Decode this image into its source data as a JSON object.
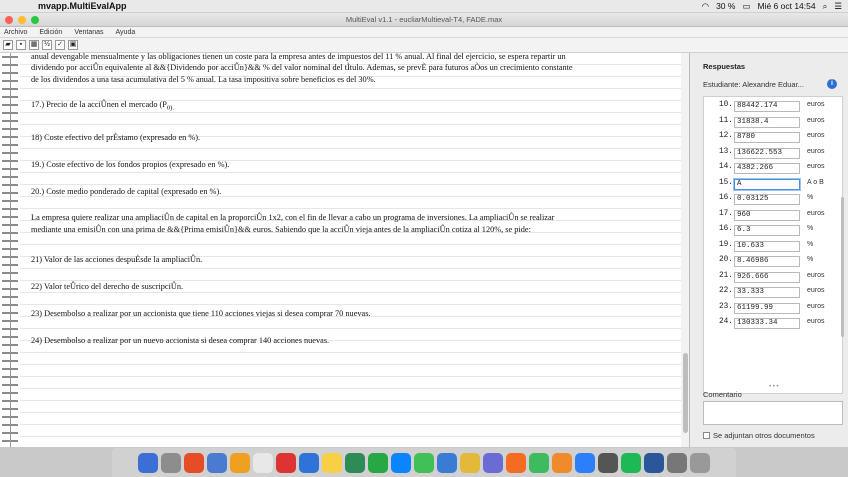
{
  "menubar": {
    "app_name": "mvapp.MultiEvalApp",
    "battery": "30 %",
    "datetime": "Mié 6 oct  14:54"
  },
  "window": {
    "title": "MultiEval v1.1 - eucliarMultieval-T4, FADE.max"
  },
  "app_menu": [
    "Archivo",
    "Edición",
    "Ventanas",
    "Ayuda"
  ],
  "document": {
    "paragraphs": [
      "anual devengable mensualmente y las obligaciones tienen un coste para la empresa antes de impuestos del 11 % anual. Al final del ejercicio, se espera repartir un",
      "dividendo por acciÛn equivalente al &&{Dividendo por acciÛn}&& % del valor nominal del tÌtulo. Ademas, se prevÈ para futuros aÒos un crecimiento constante",
      "de los dividendos a una tasa acumulativa   del 5 % anual. La tasa impositiva sobre beneficios es del 30%.",
      "17.) Precio de la acciÛnen el mercado (P",
      "18) Coste efectivo del prÈstamo (expresado en %).",
      "19.) Coste efectivo de los fondos propios (expresado en %).",
      "20.) Coste medio ponderado de capital (expresado en %).",
      "La empresa quiere realizar una ampliaciÛn de capital en la proporciÛn 1x2, con el fin de llevar a cabo un programa de inversiones. La ampliaciÛn se realizar",
      "mediante una emisiÛn con una prima de &&{Prima emisiÛn}&& euros. Sabiendo que la acciÛn vieja antes de la ampliaciÛn cotiza al 120%, se pide:",
      "21) Valor de las acciones despuÈsde la ampliaciÛn.",
      "22) Valor teÛrico del derecho de suscripciÛn.",
      "23) Desembolso a realizar por un accionista que tiene 110 acciones viejas si desea comprar 70 nuevas.",
      "24) Desembolso a realizar por un nuevo accionista si desea comprar 140 acciones nuevas."
    ],
    "subscript_p0": "0)."
  },
  "panel": {
    "title": "Respuestas",
    "student": "Estudiante: Alexandre Eduar...",
    "answers": [
      {
        "num": "10.",
        "value": "88442.174",
        "unit": "euros"
      },
      {
        "num": "11.",
        "value": "31838.4",
        "unit": "euros"
      },
      {
        "num": "12.",
        "value": "8780",
        "unit": "euros"
      },
      {
        "num": "13.",
        "value": "136622.553",
        "unit": "euros"
      },
      {
        "num": "14.",
        "value": "4382.266",
        "unit": "euros"
      },
      {
        "num": "15.",
        "value": "A",
        "unit": "A o B"
      },
      {
        "num": "16.",
        "value": "0.03125",
        "unit": "%"
      },
      {
        "num": "17.",
        "value": "960",
        "unit": "euros"
      },
      {
        "num": "16.",
        "value": "6.3",
        "unit": "%"
      },
      {
        "num": "19.",
        "value": "10.633",
        "unit": "%"
      },
      {
        "num": "20.",
        "value": "8.46986",
        "unit": "%"
      },
      {
        "num": "21.",
        "value": "926.666",
        "unit": "euros"
      },
      {
        "num": "22.",
        "value": "33.333",
        "unit": "euros"
      },
      {
        "num": "23.",
        "value": "61199.99",
        "unit": "euros"
      },
      {
        "num": "24.",
        "value": "130333.34",
        "unit": "euros"
      }
    ],
    "comment_label": "Comentario",
    "attach_label": "Se adjuntan otros documentos"
  },
  "dock_colors": [
    "#3b6fd6",
    "#8d8d8d",
    "#e44d26",
    "#4a7bd0",
    "#f0a020",
    "#e8e8e8",
    "#d33",
    "#2f73d8",
    "#f7d046",
    "#2e8b57",
    "#27a844",
    "#0a84ff",
    "#40c057",
    "#3a7bd5",
    "#e2b93b",
    "#6b6bd6",
    "#f36c21",
    "#3dbb5e",
    "#ef8b2c",
    "#2d7ff9",
    "#555",
    "#1db954",
    "#2b579a",
    "#777",
    "#999"
  ]
}
